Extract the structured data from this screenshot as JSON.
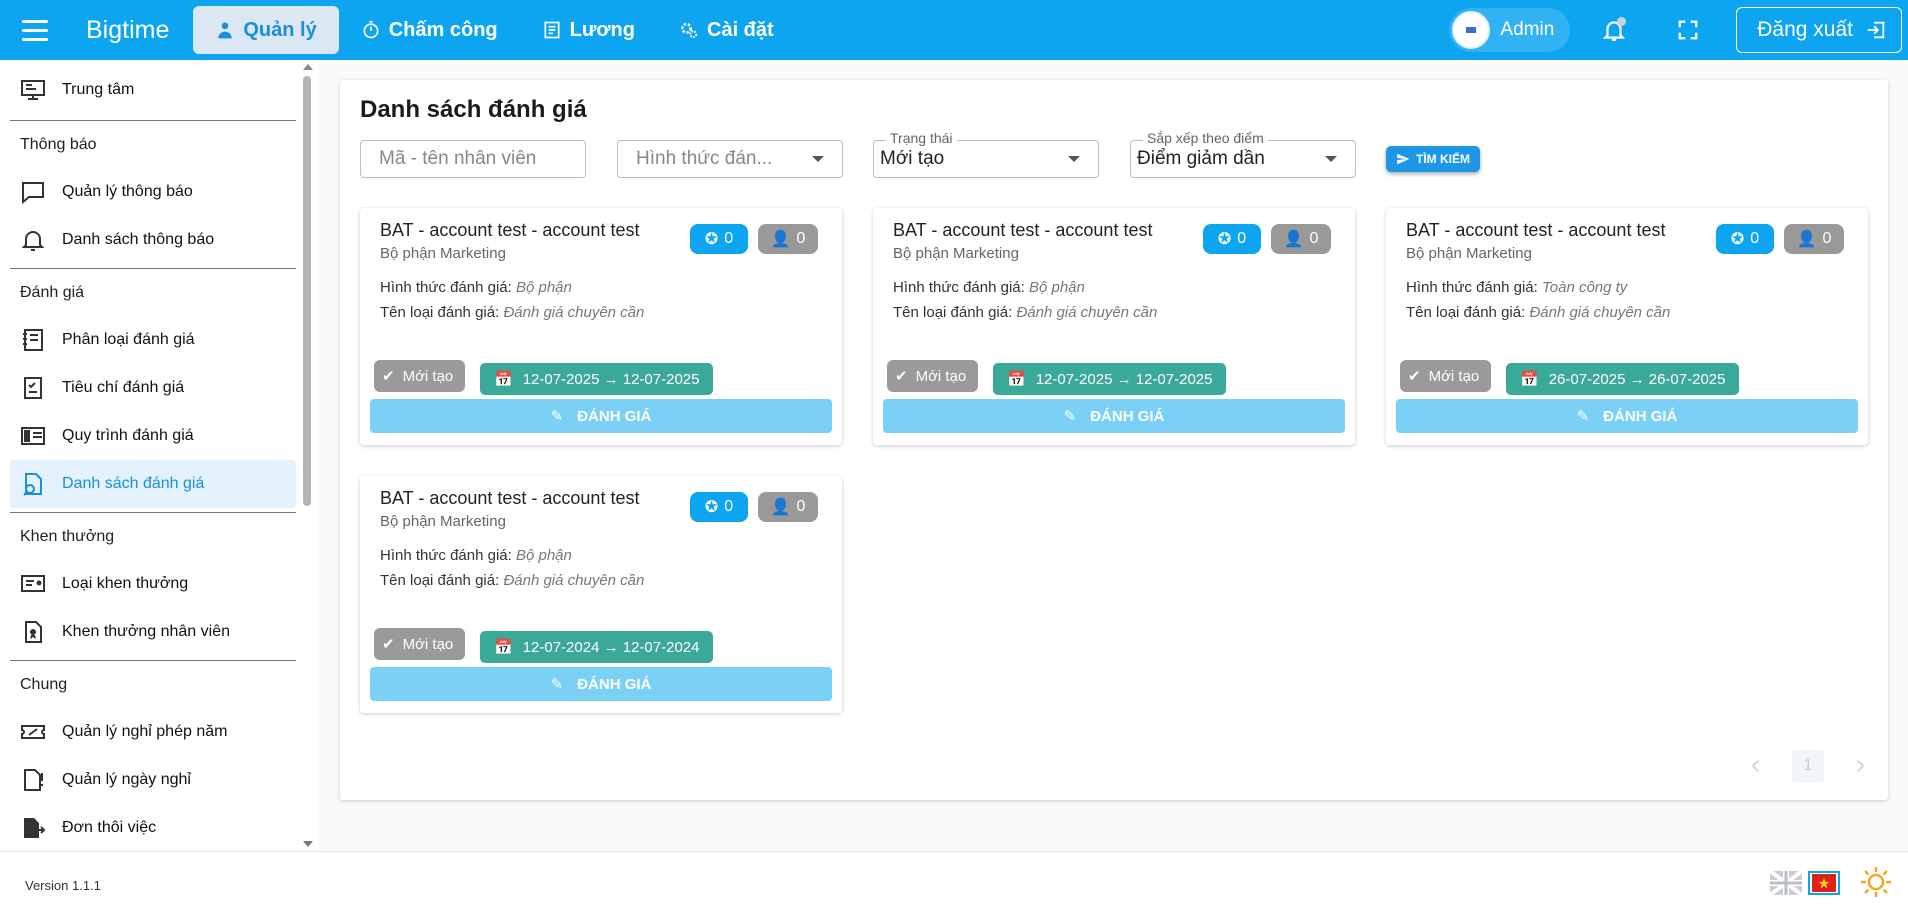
{
  "app": {
    "brand": "Bigtime",
    "nav": [
      {
        "label": "Quản lý"
      },
      {
        "label": "Chấm công"
      },
      {
        "label": "Lương"
      },
      {
        "label": "Cài đặt"
      }
    ],
    "user_name": "Admin",
    "logout_label": "Đăng xuất"
  },
  "sidebar": {
    "top_item": "Trung tâm",
    "sections": [
      {
        "title": "Thông báo",
        "items": [
          "Quản lý thông báo",
          "Danh sách thông báo"
        ]
      },
      {
        "title": "Đánh giá",
        "items": [
          "Phân loại đánh giá",
          "Tiêu chí đánh giá",
          "Quy trình đánh giá",
          "Danh sách đánh giá"
        ]
      },
      {
        "title": "Khen thưởng",
        "items": [
          "Loại khen thưởng",
          "Khen thưởng nhân viên"
        ]
      },
      {
        "title": "Chung",
        "items": [
          "Quản lý nghỉ phép năm",
          "Quản lý ngày nghỉ",
          "Đơn thôi việc"
        ]
      }
    ],
    "active_item": "Danh sách đánh giá"
  },
  "main": {
    "title": "Danh sách đánh giá",
    "filters": {
      "employee_placeholder": "Mã - tên nhân viên",
      "type_placeholder": "Hình thức đán...",
      "status_label": "Trạng thái",
      "status_value": "Mới tạo",
      "sort_label": "Sắp xếp theo điểm",
      "sort_value": "Điểm giảm dần",
      "search_label": "TÌM KIẾM"
    },
    "field_labels": {
      "type": "Hình thức đánh giá:",
      "category": "Tên loại đánh giá:"
    },
    "cards": [
      {
        "title": "BAT - account test - account test",
        "dept": "Bộ phận Marketing",
        "stars": "0",
        "users": "0",
        "type": "Bộ phận",
        "category": "Đánh giá chuyên cần",
        "status": "Mới tạo",
        "dates": "12-07-2025 → 12-07-2025",
        "action": "ĐÁNH GIÁ"
      },
      {
        "title": "BAT - account test - account test",
        "dept": "Bộ phận Marketing",
        "stars": "0",
        "users": "0",
        "type": "Bộ phận",
        "category": "Đánh giá chuyên cần",
        "status": "Mới tạo",
        "dates": "12-07-2025 → 12-07-2025",
        "action": "ĐÁNH GIÁ"
      },
      {
        "title": "BAT - account test - account test",
        "dept": "Bộ phận Marketing",
        "stars": "0",
        "users": "0",
        "type": "Toàn công ty",
        "category": "Đánh giá chuyên cần",
        "status": "Mới tạo",
        "dates": "26-07-2025 → 26-07-2025",
        "action": "ĐÁNH GIÁ"
      },
      {
        "title": "BAT - account test - account test",
        "dept": "Bộ phận Marketing",
        "stars": "0",
        "users": "0",
        "type": "Bộ phận",
        "category": "Đánh giá chuyên cần",
        "status": "Mới tạo",
        "dates": "12-07-2024 → 12-07-2024",
        "action": "ĐÁNH GIÁ"
      }
    ],
    "pagination": {
      "current_page": "1"
    }
  },
  "footer": {
    "version": "Version 1.1.1"
  },
  "colors": {
    "primary": "#0ea5f0",
    "teal_chip": "#3aa99a",
    "grey_chip": "#9a9a9a",
    "action_btn": "#7bd0f6"
  }
}
